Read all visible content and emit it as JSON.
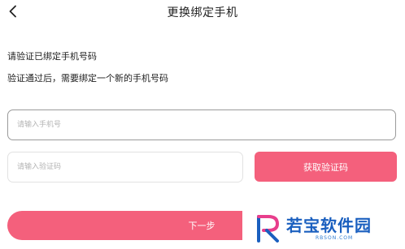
{
  "header": {
    "back_icon": "chevron-left-icon",
    "title": "更换绑定手机"
  },
  "prompts": {
    "line1": "请验证已绑定手机号码",
    "line2": "验证通过后，需要绑定一个新的手机号码"
  },
  "form": {
    "phone_placeholder": "请输入手机号",
    "phone_value": "",
    "code_placeholder": "请输入验证码",
    "code_value": "",
    "get_code_label": "获取验证码",
    "next_label": "下一步"
  },
  "colors": {
    "accent": "#f4607c",
    "watermark_blue": "#1a5fbf",
    "watermark_pink": "#e83e8c"
  },
  "watermark": {
    "text": "若宝软件园",
    "sub": "RBSON.COM"
  }
}
